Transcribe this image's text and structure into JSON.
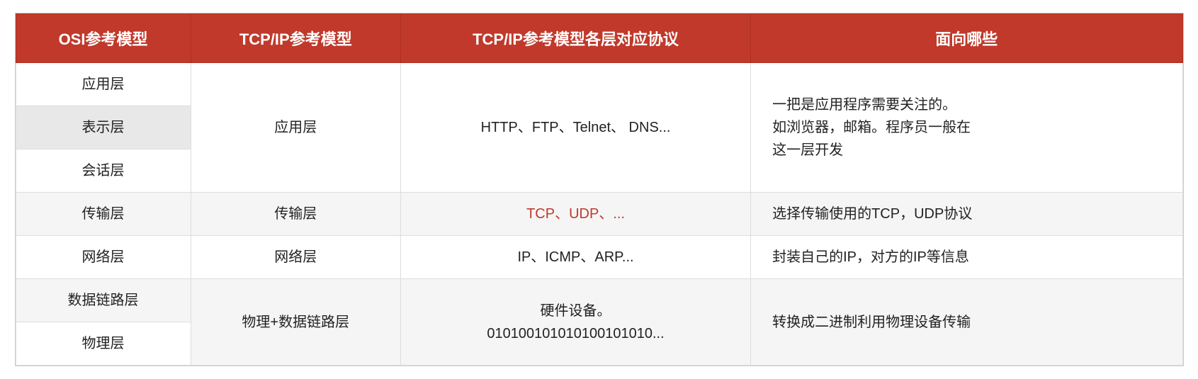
{
  "table": {
    "headers": [
      "OSI参考模型",
      "TCP/IP参考模型",
      "TCP/IP参考模型各层对应协议",
      "面向哪些"
    ],
    "rows": [
      {
        "id": "yingyong",
        "osi": "应用层",
        "tcpip": "应用层",
        "protocols": "HTTP、FTP、Telnet、 DNS...",
        "description": "一把是应用程序需要关注的。\n如浏览器，邮箱。程序员一般在\n这一层开发",
        "tcpip_rowspan": 3,
        "desc_rowspan": 3,
        "highlight": false
      },
      {
        "id": "biaoshi",
        "osi": "表示层",
        "tcpip": null,
        "protocols": null,
        "description": null,
        "highlight": true
      },
      {
        "id": "huihua",
        "osi": "会话层",
        "tcpip": null,
        "protocols": null,
        "description": null,
        "highlight": false
      },
      {
        "id": "chuanshu",
        "osi": "传输层",
        "tcpip": "传输层",
        "protocols": "TCP、UDP、...",
        "protocols_highlight": true,
        "description": "选择传输使用的TCP，UDP协议",
        "highlight": false
      },
      {
        "id": "wangluo",
        "osi": "网络层",
        "tcpip": "网络层",
        "protocols": "IP、ICMP、ARP...",
        "description": "封装自己的IP，对方的IP等信息",
        "highlight": false
      },
      {
        "id": "shujulianlu",
        "osi": "数据链路层",
        "tcpip": "物理+数据链路层",
        "protocols": "硬件设备。\n010100101010100101010...",
        "description": "转换成二进制利用物理设备传输",
        "tcpip_rowspan": 2,
        "desc_rowspan": 1,
        "highlight": false
      },
      {
        "id": "wuli",
        "osi": "物理层",
        "tcpip": null,
        "protocols": null,
        "description": null,
        "highlight": false
      }
    ]
  }
}
